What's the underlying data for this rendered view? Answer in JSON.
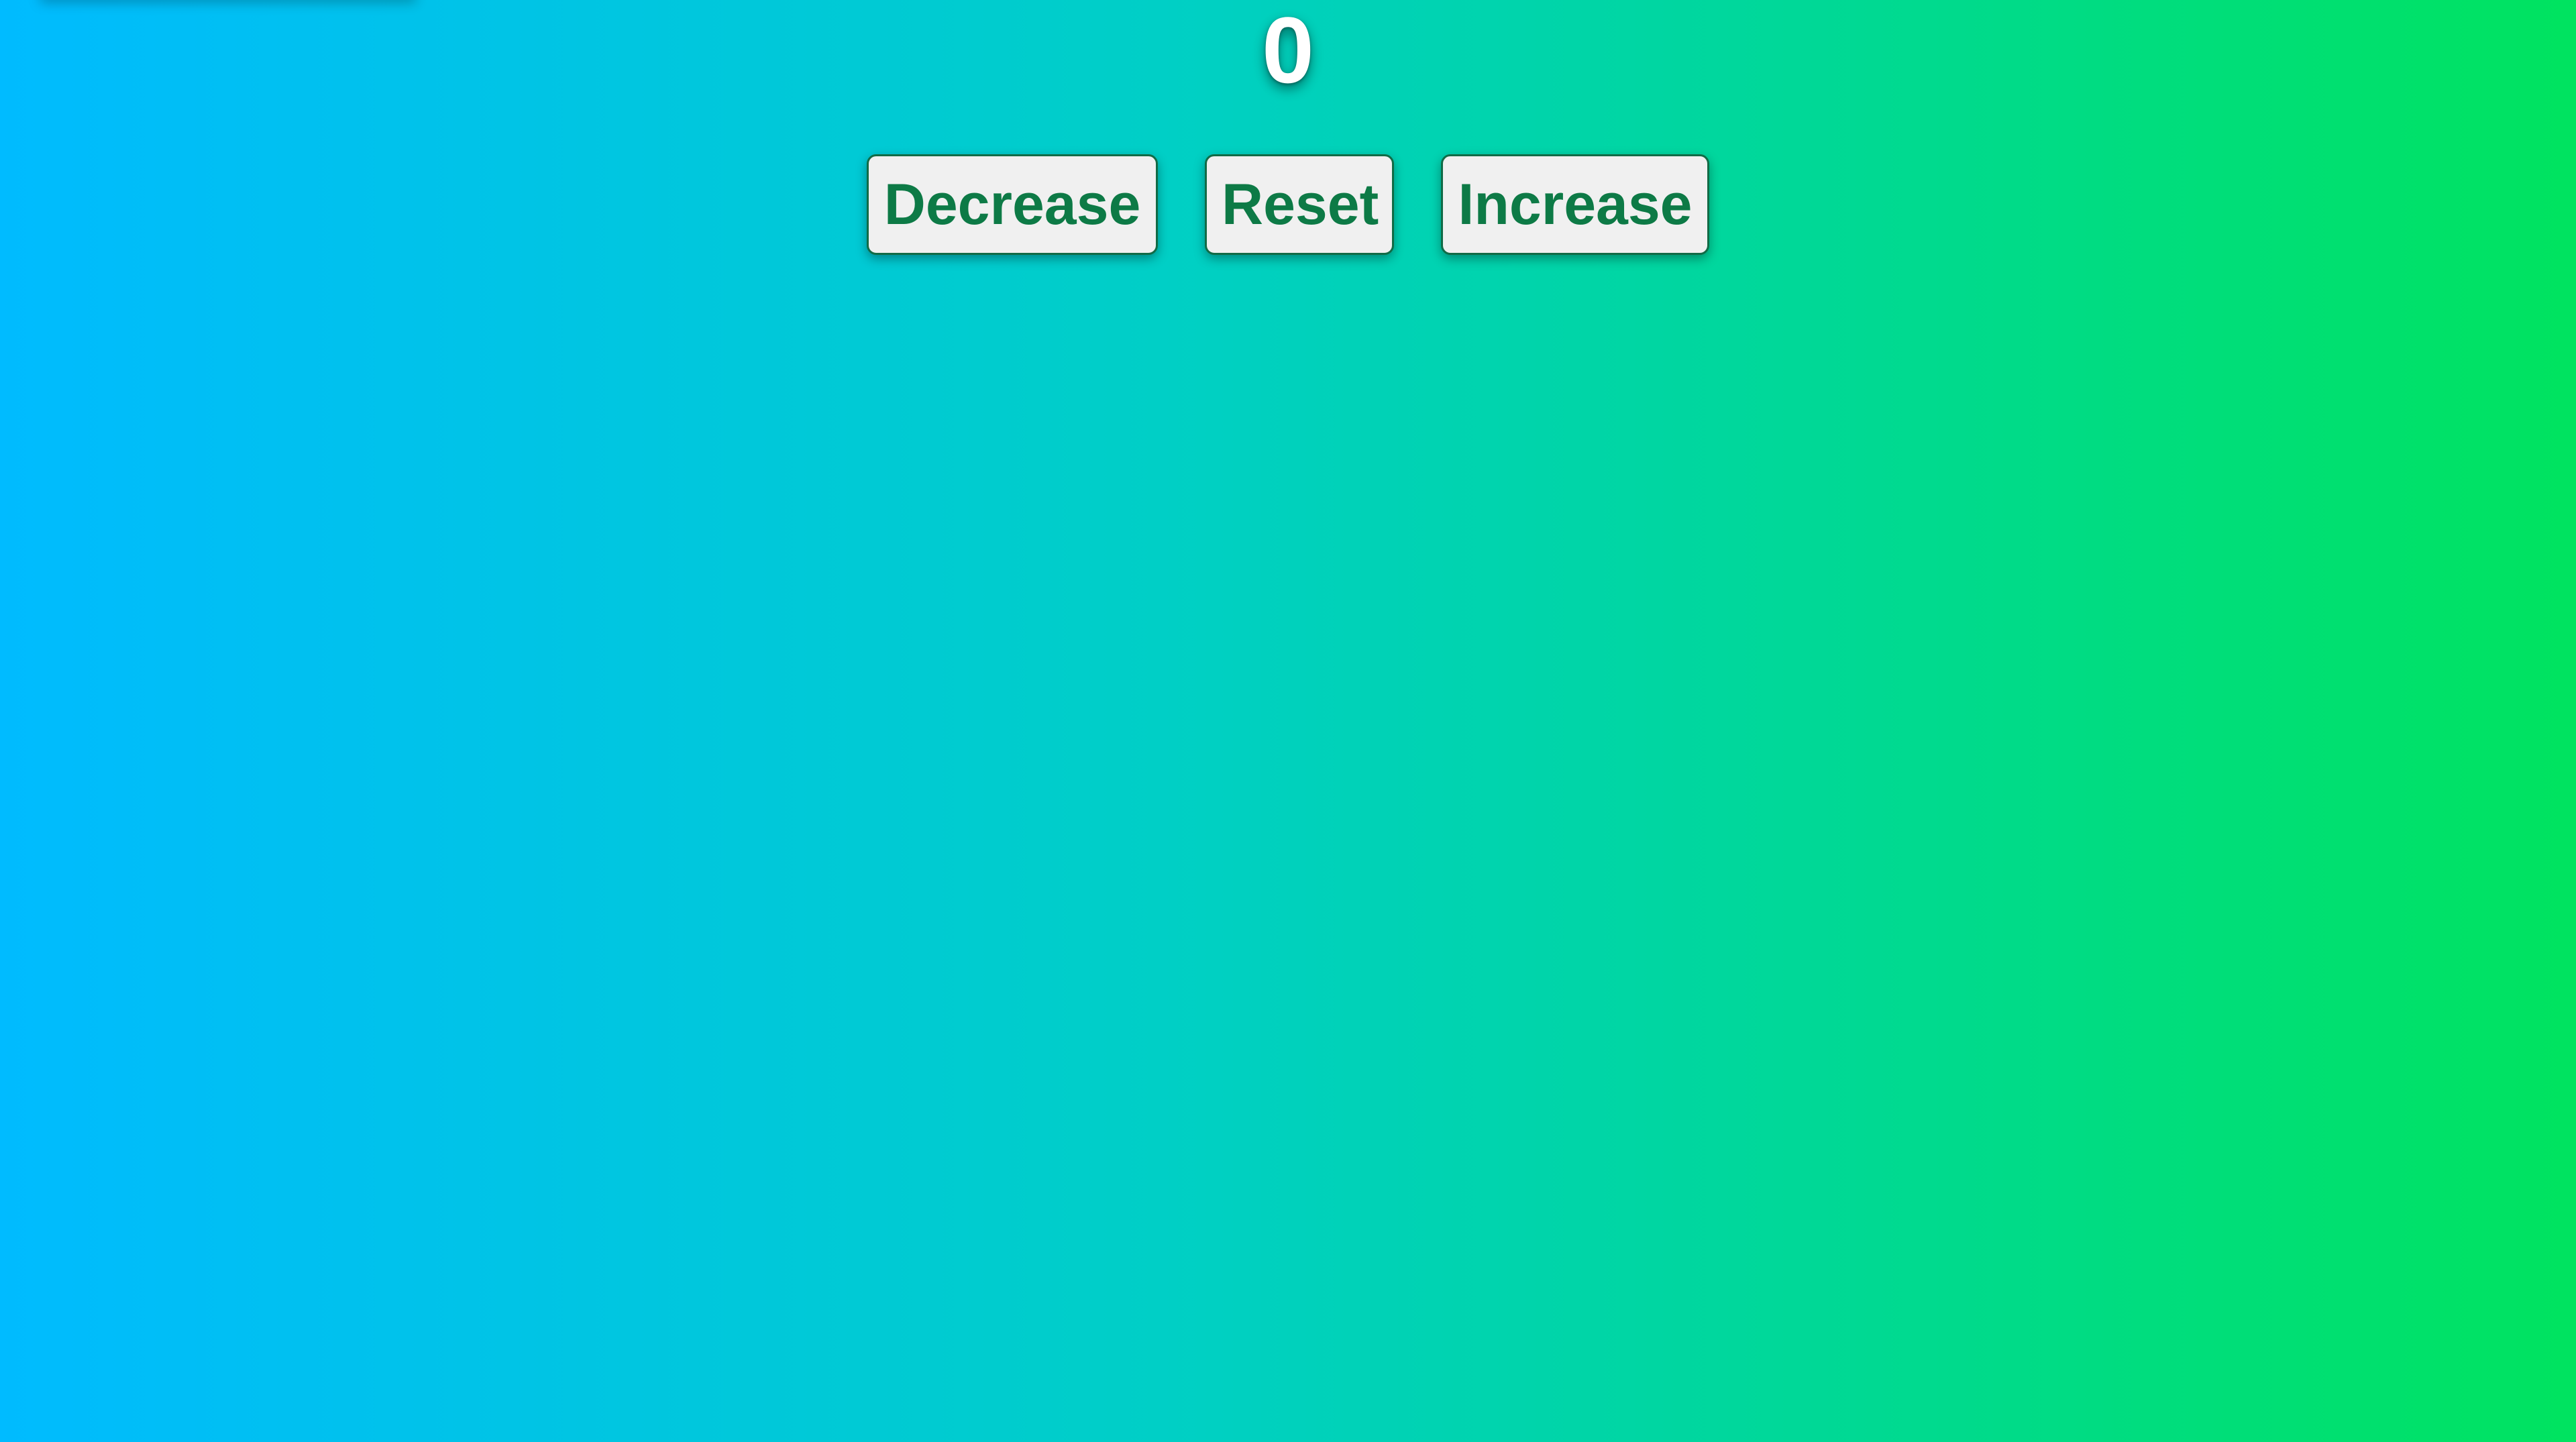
{
  "counter": {
    "value": "0"
  },
  "controls": {
    "decrease_label": "Decrease",
    "reset_label": "Reset",
    "increase_label": "Increase"
  },
  "colors": {
    "gradient_left": "#00bbff",
    "gradient_right": "#00e35f",
    "button_text": "#0d7a46",
    "button_background": "#f0f0f0"
  }
}
